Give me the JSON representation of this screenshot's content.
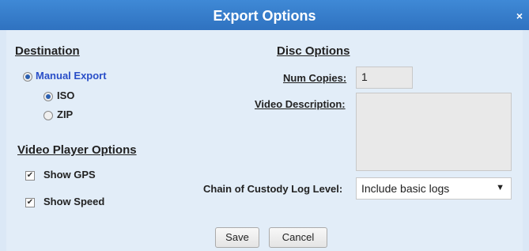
{
  "window": {
    "title": "Export Options",
    "close_glyph": "×"
  },
  "destination": {
    "heading": "Destination",
    "manual_export": "Manual Export",
    "formats": [
      "ISO",
      "ZIP"
    ]
  },
  "video_player": {
    "heading": "Video Player Options",
    "show_gps": "Show GPS",
    "show_speed": "Show Speed"
  },
  "disc": {
    "heading": "Disc Options",
    "num_copies_label": "Num Copies:",
    "num_copies_value": "1",
    "video_description_label": "Video Description:",
    "video_description_value": ""
  },
  "chain": {
    "label": "Chain of Custody Log Level:",
    "selected": "Include basic logs",
    "arrow_glyph": "▼"
  },
  "buttons": {
    "save": "Save",
    "cancel": "Cancel"
  },
  "icons": {
    "check_glyph": "✔"
  }
}
